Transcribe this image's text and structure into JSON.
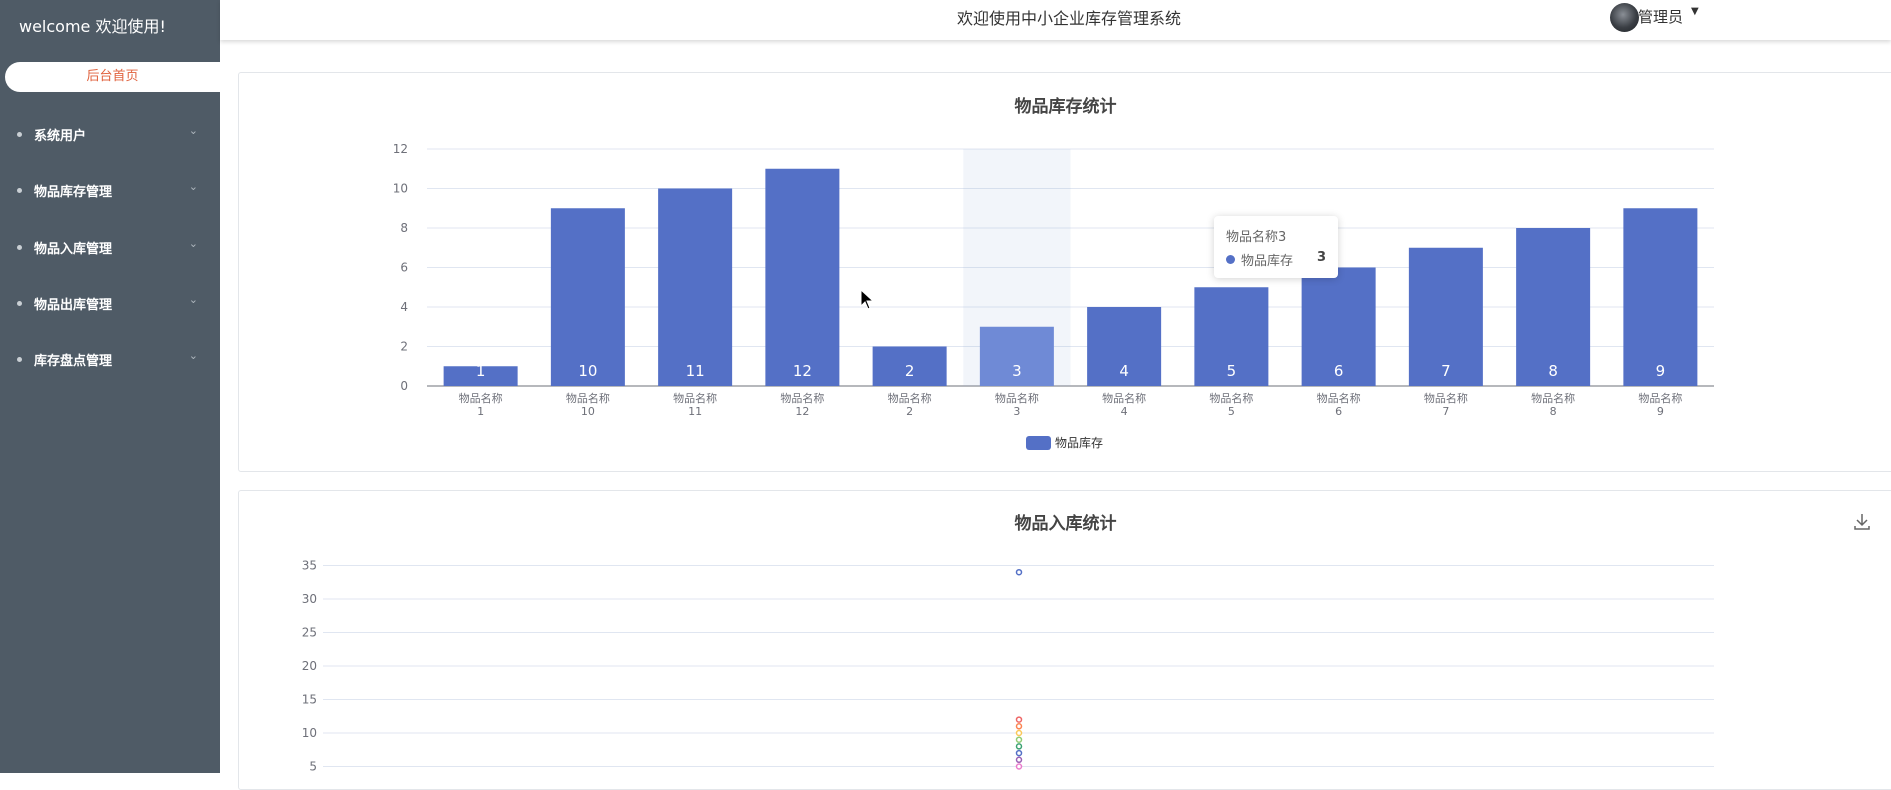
{
  "sidebar": {
    "welcome": "welcome 欢迎使用!",
    "home": "后台首页",
    "items": [
      {
        "label": "系统用户"
      },
      {
        "label": "物品库存管理"
      },
      {
        "label": "物品入库管理"
      },
      {
        "label": "物品出库管理"
      },
      {
        "label": "库存盘点管理"
      }
    ]
  },
  "header": {
    "title": "欢迎使用中小企业库存管理系统",
    "user": "管理员"
  },
  "colors": {
    "sidebar": "#4f5b66",
    "accent": "#e0623e",
    "bar": "#5470c6"
  },
  "tooltip": {
    "title": "物品名称3",
    "series": "物品库存",
    "value": "3"
  },
  "chart_data": [
    {
      "type": "bar",
      "title": "物品库存统计",
      "categories": [
        [
          "物品名称",
          "1"
        ],
        [
          "物品名称",
          "10"
        ],
        [
          "物品名称",
          "11"
        ],
        [
          "物品名称",
          "12"
        ],
        [
          "物品名称",
          "2"
        ],
        [
          "物品名称",
          "3"
        ],
        [
          "物品名称",
          "4"
        ],
        [
          "物品名称",
          "5"
        ],
        [
          "物品名称",
          "6"
        ],
        [
          "物品名称",
          "7"
        ],
        [
          "物品名称",
          "8"
        ],
        [
          "物品名称",
          "9"
        ]
      ],
      "series": [
        {
          "name": "物品库存",
          "values": [
            1,
            9,
            10,
            11,
            2,
            3,
            4,
            5,
            6,
            7,
            8,
            9
          ],
          "labels": [
            "1",
            "10",
            "11",
            "12",
            "2",
            "3",
            "4",
            "5",
            "6",
            "7",
            "8",
            "9"
          ]
        }
      ],
      "ylim": [
        0,
        12
      ],
      "yticks": [
        0,
        2,
        4,
        6,
        8,
        10,
        12
      ],
      "highlight_index": 5,
      "legend": "bottom-center",
      "grid": true
    },
    {
      "type": "scatter",
      "title": "物品入库统计",
      "ylim": [
        0,
        35
      ],
      "yticks": [
        5,
        10,
        15,
        20,
        25,
        30,
        35
      ],
      "points": [
        {
          "y": 34,
          "color": "#5470c6"
        },
        {
          "y": 12,
          "color": "#ee6666"
        },
        {
          "y": 11,
          "color": "#fc8452"
        },
        {
          "y": 10,
          "color": "#fac858"
        },
        {
          "y": 9,
          "color": "#91cc75"
        },
        {
          "y": 8,
          "color": "#3ba272"
        },
        {
          "y": 7,
          "color": "#5470c6"
        },
        {
          "y": 6,
          "color": "#9a60b4"
        },
        {
          "y": 5,
          "color": "#ea7ccc"
        }
      ],
      "grid": true
    }
  ]
}
